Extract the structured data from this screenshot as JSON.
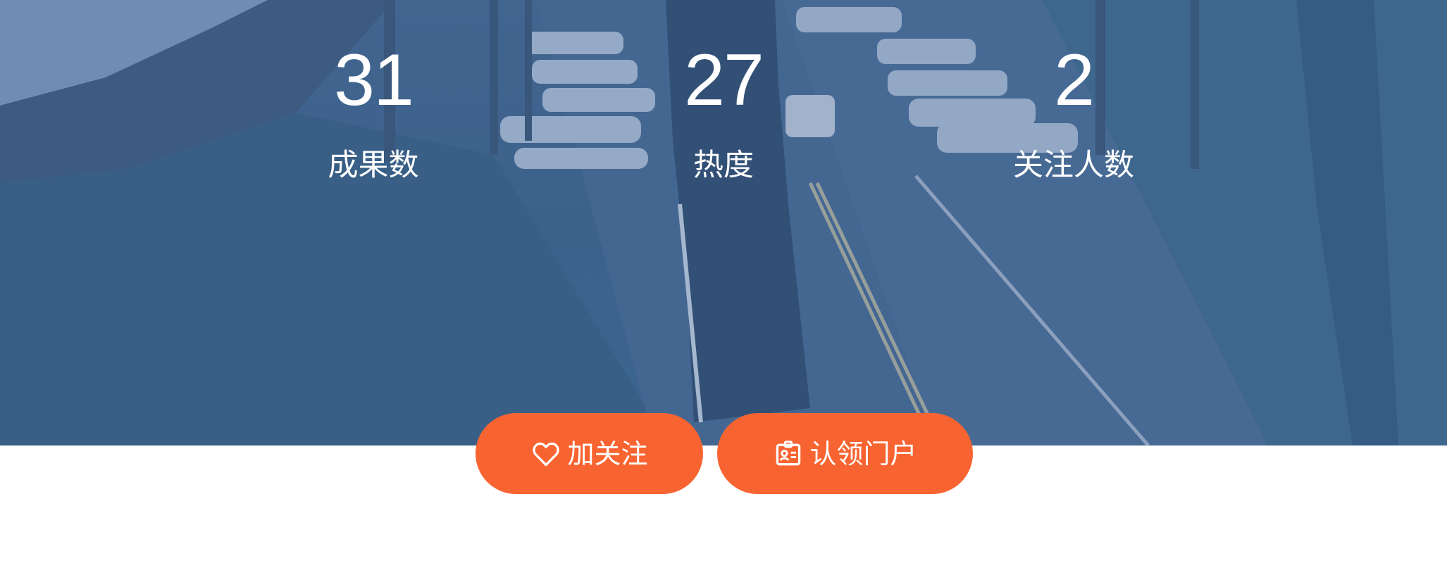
{
  "stats": [
    {
      "value": "31",
      "label": "成果数"
    },
    {
      "value": "27",
      "label": "热度"
    },
    {
      "value": "2",
      "label": "关注人数"
    }
  ],
  "actions": {
    "follow_label": "加关注",
    "follow_icon": "heart-icon",
    "claim_label": "认领门户",
    "claim_icon": "id-badge-icon"
  },
  "colors": {
    "hero_overlay": "#3d6388",
    "button": "#f86431",
    "text_on_hero": "#ffffff"
  }
}
